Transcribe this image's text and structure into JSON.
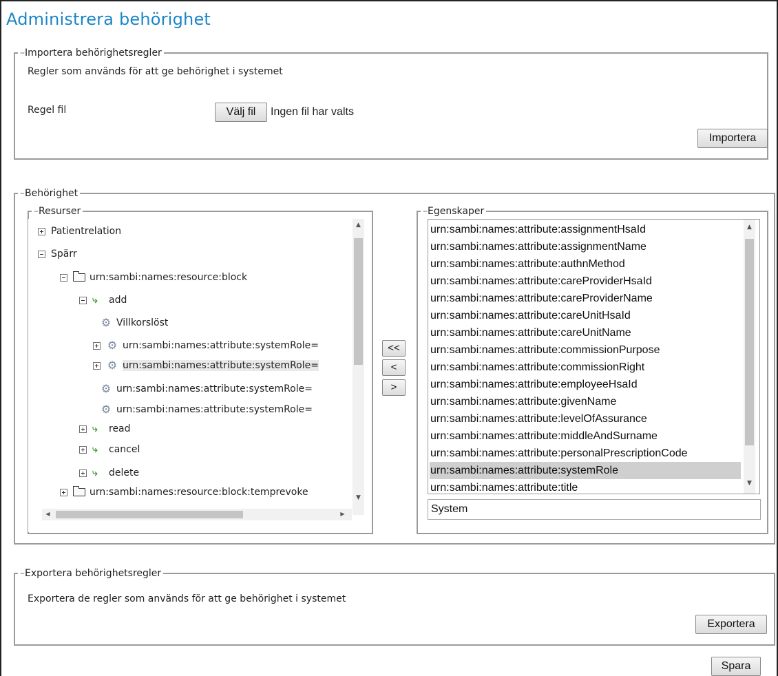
{
  "page": {
    "title": "Administrera behörighet"
  },
  "import": {
    "legend": "Importera behörighetsregler",
    "description": "Regler som används för att ge behörighet i systemet",
    "file_label": "Regel fil",
    "choose_file_button": "Välj fil",
    "no_file_text": "Ingen fil har valts",
    "import_button": "Importera"
  },
  "permissions": {
    "legend": "Behörighet",
    "resources": {
      "legend": "Resurser",
      "tree": [
        {
          "label": "Patientrelation",
          "toggle": "plus",
          "icon": ""
        },
        {
          "label": "Spärr",
          "toggle": "minus",
          "icon": ""
        },
        {
          "label": "urn:sambi:names:resource:block",
          "toggle": "minus",
          "icon": "folder-icon"
        },
        {
          "label": "add",
          "toggle": "minus",
          "icon": "action-icon"
        },
        {
          "label": "Villkorslöst",
          "toggle": "",
          "icon": "gear-icon"
        },
        {
          "label": "urn:sambi:names:attribute:systemRole=",
          "toggle": "plus",
          "icon": "gear-icon"
        },
        {
          "label": "urn:sambi:names:attribute:systemRole=",
          "toggle": "plus",
          "icon": "gear-icon",
          "selected": true
        },
        {
          "label": "urn:sambi:names:attribute:systemRole=",
          "toggle": "",
          "icon": "gear-icon"
        },
        {
          "label": "urn:sambi:names:attribute:systemRole=",
          "toggle": "",
          "icon": "gear-icon"
        },
        {
          "label": "read",
          "toggle": "plus",
          "icon": "action-icon"
        },
        {
          "label": "cancel",
          "toggle": "plus",
          "icon": "action-icon"
        },
        {
          "label": "delete",
          "toggle": "plus",
          "icon": "action-icon"
        },
        {
          "label": "urn:sambi:names:resource:block:temprevoke",
          "toggle": "plus",
          "icon": "folder-icon"
        }
      ]
    },
    "move_buttons": {
      "all_left": "<<",
      "left": "<",
      "right": ">"
    },
    "properties": {
      "legend": "Egenskaper",
      "items": [
        "urn:sambi:names:attribute:assignmentHsaId",
        "urn:sambi:names:attribute:assignmentName",
        "urn:sambi:names:attribute:authnMethod",
        "urn:sambi:names:attribute:careProviderHsaId",
        "urn:sambi:names:attribute:careProviderName",
        "urn:sambi:names:attribute:careUnitHsaId",
        "urn:sambi:names:attribute:careUnitName",
        "urn:sambi:names:attribute:commissionPurpose",
        "urn:sambi:names:attribute:commissionRight",
        "urn:sambi:names:attribute:employeeHsaId",
        "urn:sambi:names:attribute:givenName",
        "urn:sambi:names:attribute:levelOfAssurance",
        "urn:sambi:names:attribute:middleAndSurname",
        "urn:sambi:names:attribute:personalPrescriptionCode",
        "urn:sambi:names:attribute:systemRole",
        "urn:sambi:names:attribute:title"
      ],
      "selected_item": "urn:sambi:names:attribute:systemRole",
      "value": "System"
    }
  },
  "export": {
    "legend": "Exportera behörighetsregler",
    "description": "Exportera de regler som används för att ge behörighet i systemet",
    "export_button": "Exportera"
  },
  "save_button": "Spara"
}
